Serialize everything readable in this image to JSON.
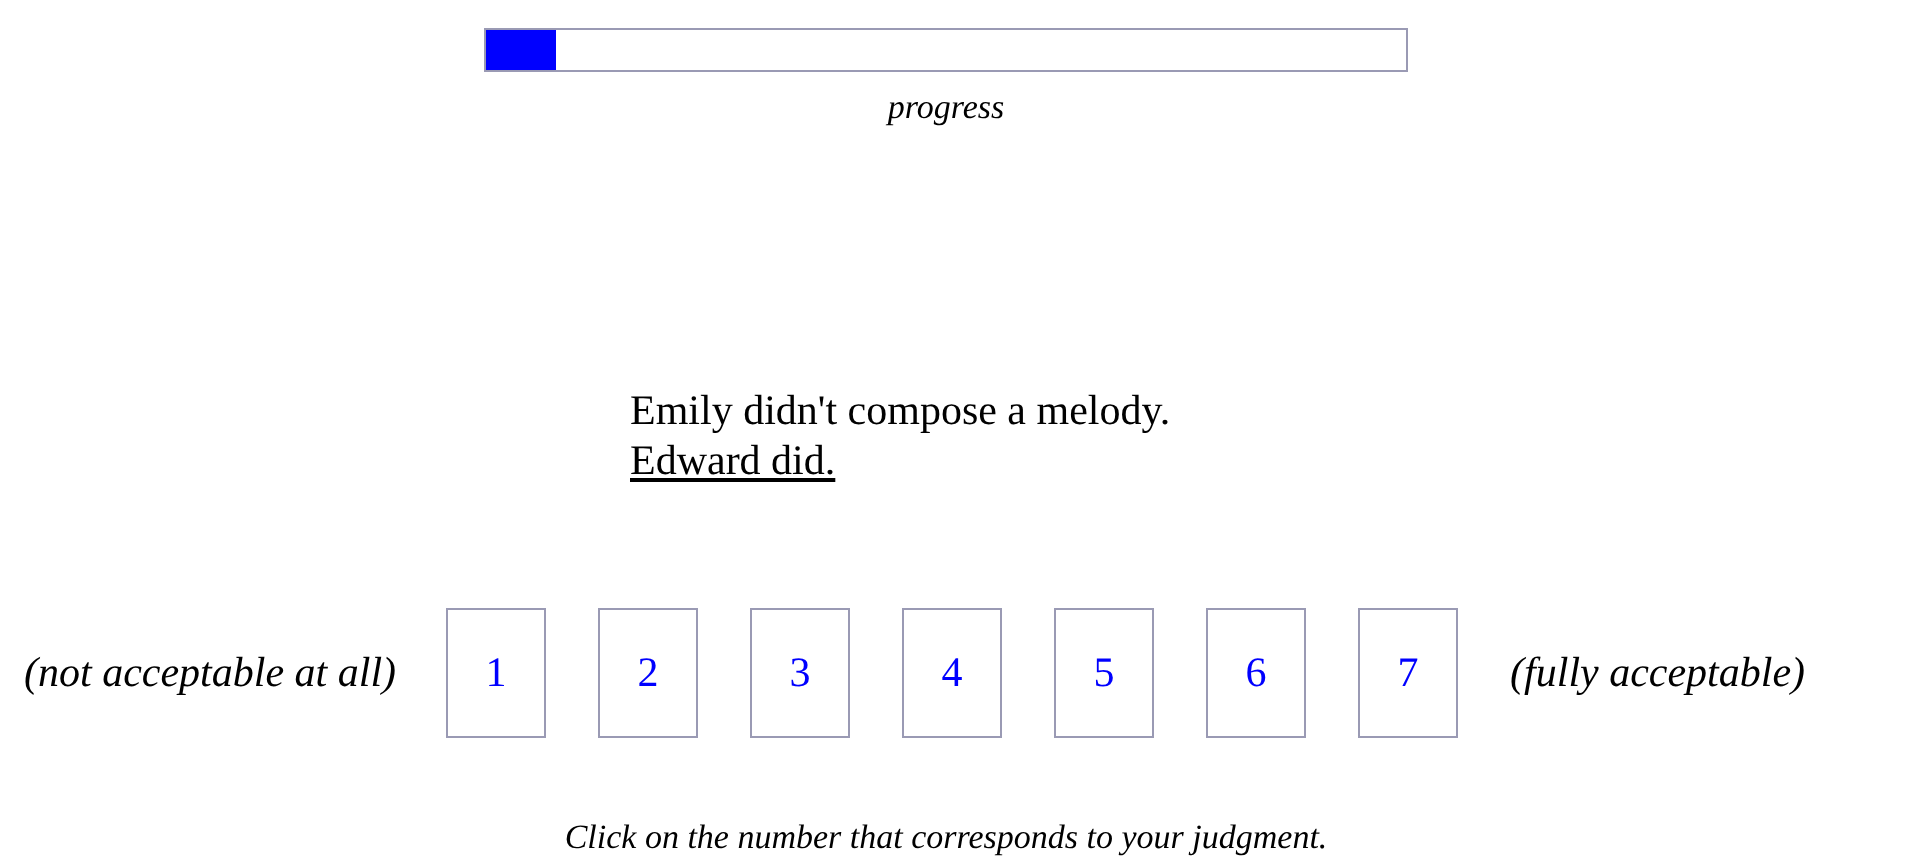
{
  "progress": {
    "level": 0.076,
    "label": "progress"
  },
  "sentences": [
    {
      "text": "Emily didn't compose a melody.",
      "underlined": false
    },
    {
      "text": "Edward did.",
      "underlined": true
    }
  ],
  "scale": {
    "left_label": "(not acceptable at all)",
    "right_label": "(fully acceptable)",
    "options": [
      "1",
      "2",
      "3",
      "4",
      "5",
      "6",
      "7"
    ]
  },
  "instruction": "Click on the number that corresponds to your judgment."
}
